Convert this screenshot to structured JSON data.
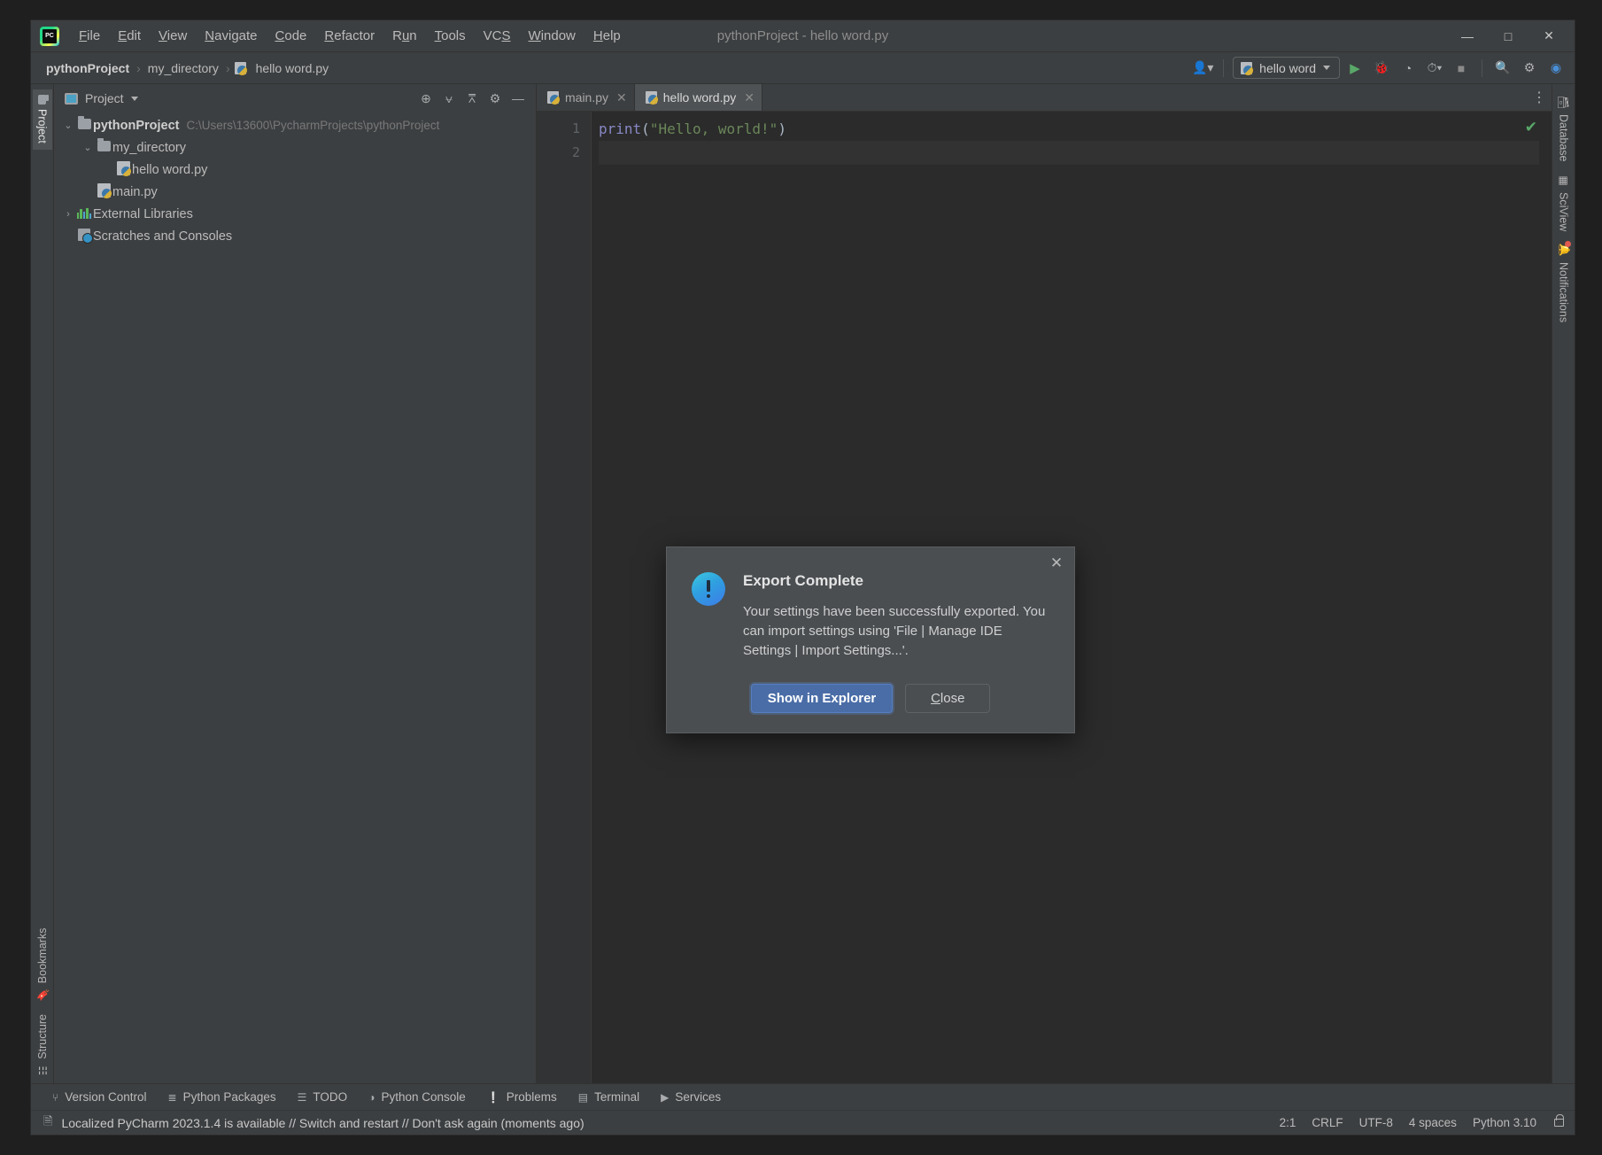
{
  "window": {
    "title": "pythonProject - hello word.py",
    "logo_icon": "pycharm-logo-icon",
    "minimize_label": "—",
    "maximize_label": "□",
    "close_label": "✕"
  },
  "menu": [
    {
      "pre": "",
      "accel": "F",
      "post": "ile"
    },
    {
      "pre": "",
      "accel": "E",
      "post": "dit"
    },
    {
      "pre": "",
      "accel": "V",
      "post": "iew"
    },
    {
      "pre": "",
      "accel": "N",
      "post": "avigate"
    },
    {
      "pre": "",
      "accel": "C",
      "post": "ode"
    },
    {
      "pre": "",
      "accel": "R",
      "post": "efactor"
    },
    {
      "pre": "R",
      "accel": "u",
      "post": "n"
    },
    {
      "pre": "",
      "accel": "T",
      "post": "ools"
    },
    {
      "pre": "VC",
      "accel": "S",
      "post": ""
    },
    {
      "pre": "",
      "accel": "W",
      "post": "indow"
    },
    {
      "pre": "",
      "accel": "H",
      "post": "elp"
    }
  ],
  "breadcrumb": {
    "items": [
      "pythonProject",
      "my_directory",
      "hello word.py"
    ],
    "separator": "›"
  },
  "toolbar": {
    "account_icon": "user-account-icon",
    "run_config": {
      "icon": "python-file-icon",
      "label": "hello word"
    },
    "run_icon": "run-play-icon",
    "debug_icon": "debug-bug-icon",
    "run_coverage_icon": "run-with-coverage-icon",
    "profile_icon": "profiler-icon",
    "stop_icon": "stop-square-icon",
    "search_icon": "search-everywhere-icon",
    "settings_icon": "settings-gear-icon",
    "updates_icon": "ide-updates-icon"
  },
  "left_stripe": {
    "top": [
      {
        "label": "Project",
        "icon": "project-folder-icon",
        "selected": true
      }
    ],
    "bottom": [
      {
        "label": "Bookmarks",
        "icon": "bookmark-icon",
        "selected": false
      },
      {
        "label": "Structure",
        "icon": "structure-icon",
        "selected": false
      }
    ]
  },
  "right_stripe": [
    {
      "label": "Database",
      "icon": "database-icon"
    },
    {
      "label": "SciView",
      "icon": "sciview-grid-icon"
    },
    {
      "label": "Notifications",
      "icon": "notifications-bell-icon",
      "badge": true
    }
  ],
  "project_panel": {
    "title": "Project",
    "view_icon": "project-view-icon",
    "dropdown_icon": "chevron-down-icon",
    "actions": [
      {
        "name": "select-opened-file-icon",
        "glyph": "⊕"
      },
      {
        "name": "expand-all-icon",
        "glyph": "⩝"
      },
      {
        "name": "collapse-all-icon",
        "glyph": "⩞"
      },
      {
        "name": "settings-gear-icon",
        "glyph": "⚙"
      },
      {
        "name": "hide-panel-icon",
        "glyph": "—"
      }
    ],
    "tree": [
      {
        "indent": 0,
        "arrow": "⌄",
        "icon": "folder-icon",
        "name": "pythonProject",
        "bold": true,
        "path": "C:\\Users\\13600\\PycharmProjects\\pythonProject"
      },
      {
        "indent": 1,
        "arrow": "⌄",
        "icon": "folder-icon",
        "name": "my_directory",
        "bold": false,
        "path": ""
      },
      {
        "indent": 2,
        "arrow": "",
        "icon": "python-file-icon",
        "name": "hello word.py",
        "bold": false,
        "path": ""
      },
      {
        "indent": 1,
        "arrow": "",
        "icon": "python-file-icon",
        "name": "main.py",
        "bold": false,
        "path": ""
      },
      {
        "indent": 0,
        "arrow": "›",
        "icon": "external-libraries-icon",
        "name": "External Libraries",
        "bold": false,
        "path": ""
      },
      {
        "indent": 0,
        "arrow": "",
        "icon": "scratches-icon",
        "name": "Scratches and Consoles",
        "bold": false,
        "path": ""
      }
    ]
  },
  "editor": {
    "tabs": [
      {
        "label": "main.py",
        "icon": "python-file-icon",
        "active": false,
        "close_glyph": "✕"
      },
      {
        "label": "hello word.py",
        "icon": "python-file-icon",
        "active": true,
        "close_glyph": "✕"
      }
    ],
    "more_icon": "more-options-icon",
    "gutter_lines": [
      "1",
      "2"
    ],
    "code_lines": [
      {
        "tokens": [
          {
            "t": "print",
            "c": "k-fn"
          },
          {
            "t": "(",
            "c": "k-punct"
          },
          {
            "t": "\"Hello, world!\"",
            "c": "k-str"
          },
          {
            "t": ")",
            "c": "k-punct"
          }
        ]
      },
      {
        "tokens": []
      }
    ],
    "inspection_icon": "inspection-ok-checkmark",
    "inspection_glyph": "✔"
  },
  "dialog": {
    "title": "Export Complete",
    "icon": "info-exclamation-icon",
    "close_glyph": "✕",
    "message": "Your settings have been successfully exported. You can import settings using 'File | Manage IDE Settings | Import Settings...'.",
    "primary_button": "Show in Explorer",
    "secondary_button_pre": "",
    "secondary_button_accel": "C",
    "secondary_button_post": "lose"
  },
  "bottom_tools": [
    {
      "label": "Version Control",
      "icon": "version-control-branch-icon",
      "glyph": "⑂"
    },
    {
      "label": "Python Packages",
      "icon": "python-packages-icon",
      "glyph": "≣"
    },
    {
      "label": "TODO",
      "icon": "todo-list-icon",
      "glyph": "☰"
    },
    {
      "label": "Python Console",
      "icon": "python-console-icon",
      "glyph": "◑"
    },
    {
      "label": "Problems",
      "icon": "problems-warning-icon",
      "glyph": "❕"
    },
    {
      "label": "Terminal",
      "icon": "terminal-icon",
      "glyph": "▤"
    },
    {
      "label": "Services",
      "icon": "services-icon",
      "glyph": "▶"
    }
  ],
  "status_bar": {
    "notification_icon": "notification-event-log-icon",
    "notification": "Localized PyCharm 2023.1.4 is available // Switch and restart // Don't ask again (moments ago)",
    "caret_position": "2:1",
    "line_separator": "CRLF",
    "encoding": "UTF-8",
    "indent": "4 spaces",
    "interpreter": "Python 3.10",
    "lock_icon": "read-only-lock-icon"
  },
  "colors": {
    "panel_bg": "#3c3f41",
    "editor_bg": "#2b2b2b",
    "accent_blue": "#4a6da7",
    "string_green": "#6a8759",
    "keyword_violet": "#8888c6"
  }
}
